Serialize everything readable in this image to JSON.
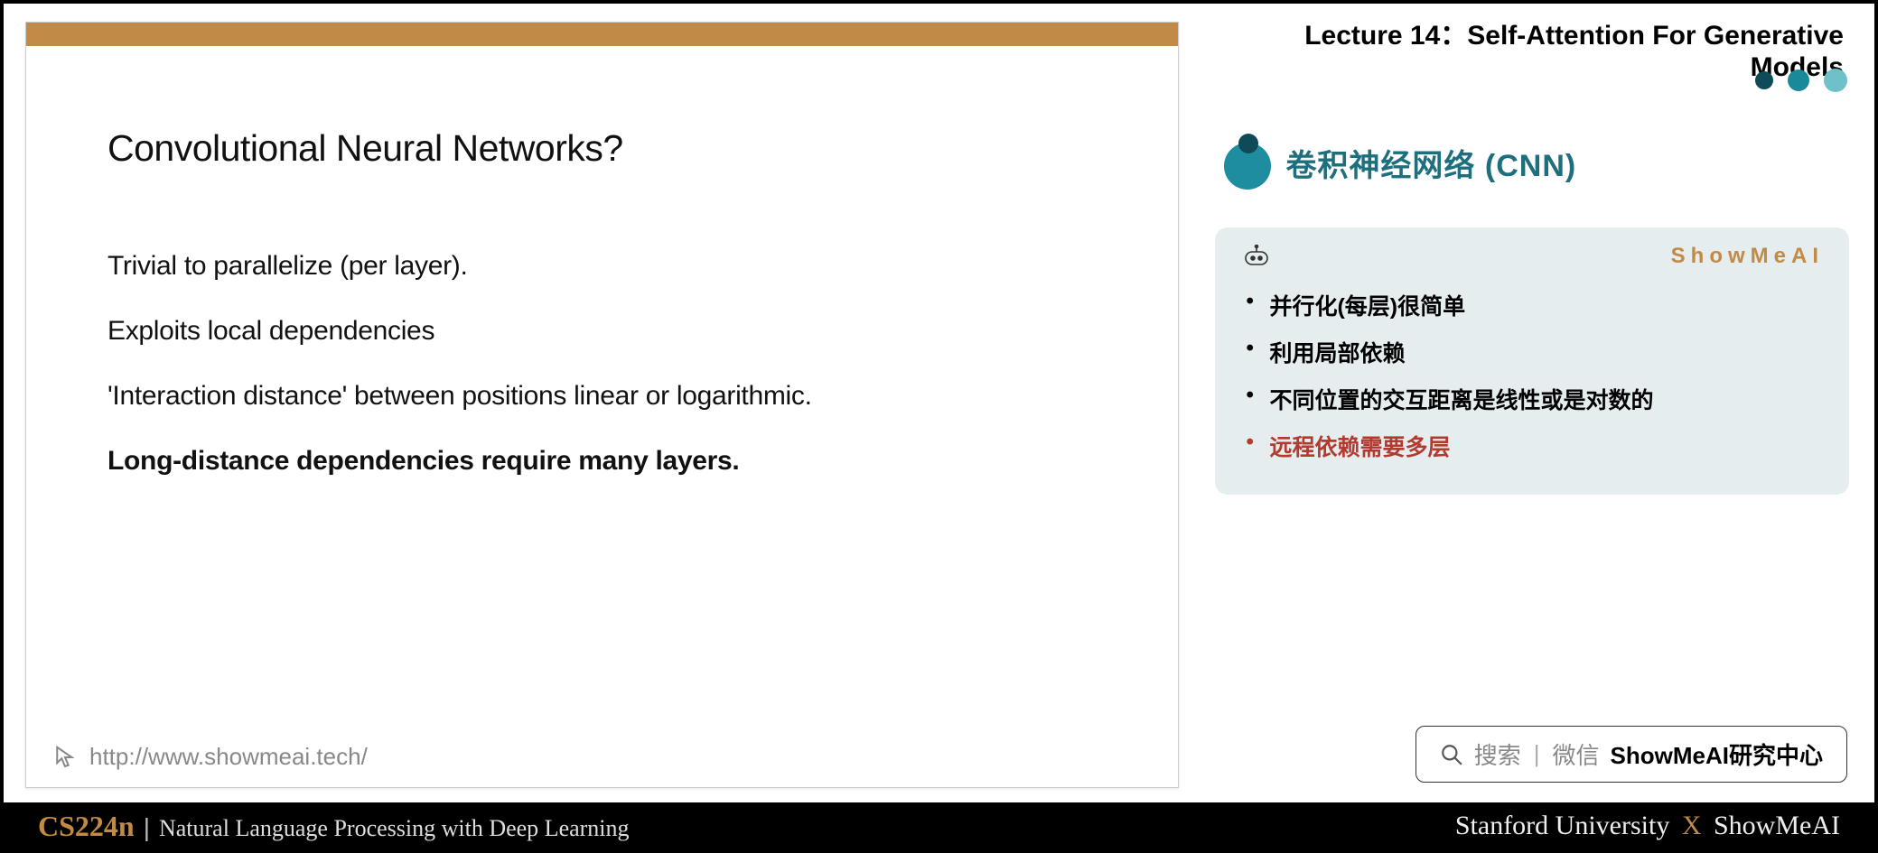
{
  "lecture_header": "Lecture 14：Self-Attention For Generative Models",
  "section_title": "卷积神经网络 (CNN)",
  "slide": {
    "title": "Convolutional Neural Networks?",
    "lines": [
      {
        "text": "Trivial to parallelize (per layer).",
        "bold": false
      },
      {
        "text": "Exploits local dependencies",
        "bold": false
      },
      {
        "text": "'Interaction distance' between positions linear or logarithmic.",
        "bold": false
      },
      {
        "text": "Long-distance dependencies require many layers.",
        "bold": true
      }
    ],
    "footer_url": "http://www.showmeai.tech/"
  },
  "info_card": {
    "brand": "ShowMeAI",
    "bullets": [
      {
        "text": "并行化(每层)很简单",
        "red": false
      },
      {
        "text": "利用局部依赖",
        "red": false
      },
      {
        "text": "不同位置的交互距离是线性或是对数的",
        "red": false
      },
      {
        "text": "远程依赖需要多层",
        "red": true
      }
    ]
  },
  "search": {
    "hint1": "搜索",
    "hint2": "微信",
    "bold": "ShowMeAI研究中心"
  },
  "footer": {
    "code": "CS224n",
    "name": "Natural Language Processing with Deep Learning",
    "uni": "Stanford University",
    "partner": "ShowMeAI"
  }
}
